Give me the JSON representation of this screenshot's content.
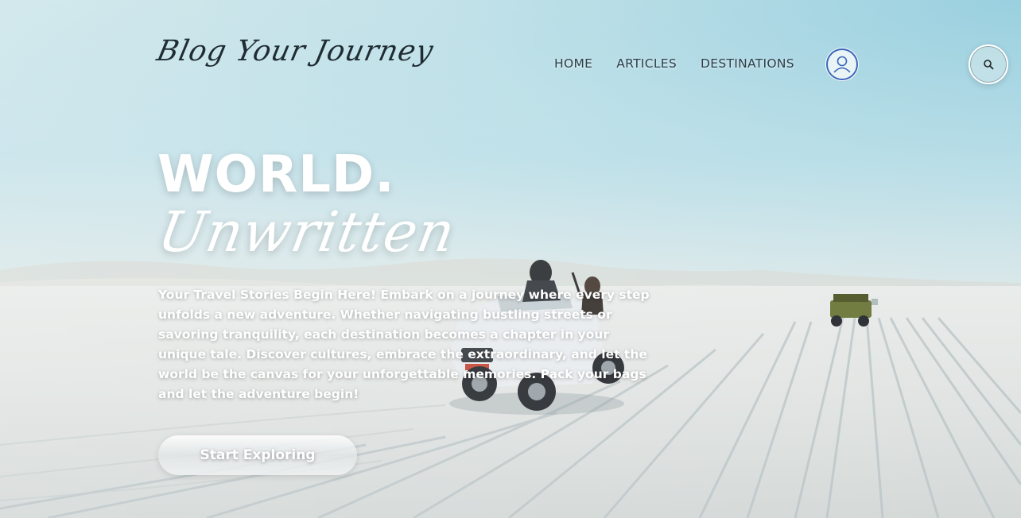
{
  "header": {
    "logo_text": "Blog Your Journey",
    "nav": [
      {
        "label": "HOME"
      },
      {
        "label": "ARTICLES"
      },
      {
        "label": "DESTINATIONS"
      }
    ],
    "profile_icon": "user-icon",
    "search_icon": "search-icon"
  },
  "hero": {
    "headline": "WORLD.",
    "subheadline": "Unwritten",
    "description": "Your Travel Stories Begin Here! Embark on a journey where every step unfolds a new adventure. Whether navigating bustling streets or savoring tranquility, each destination becomes a chapter in your unique tale. Discover cultures, embrace the extraordinary, and let the world be the canvas for your unforgettable memories. Pack your bags and let the adventure begin!",
    "cta_label": "Start Exploring"
  },
  "colors": {
    "accent_ring": "#3a66b8",
    "text_dark": "#2c3e4a",
    "hero_text": "#ffffff"
  }
}
